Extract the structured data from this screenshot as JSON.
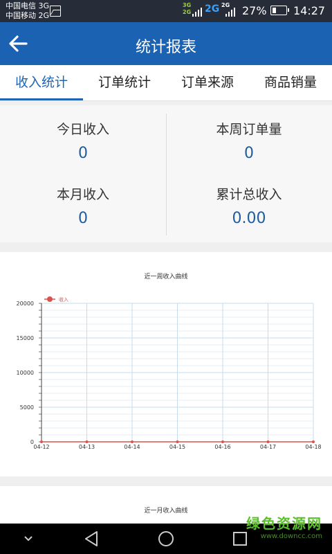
{
  "status_bar": {
    "carrier_1": "中国电信 3G",
    "carrier_2": "中国移动 2G",
    "net_3g_top": "3G",
    "net_3g_bottom": "2G",
    "net_2g": "2G",
    "net_2g_small": "2G",
    "battery": "27%",
    "battery_level": 0.27,
    "time": "14:27",
    "icons": [
      "photo-icon",
      "signal-icon",
      "battery-icon"
    ]
  },
  "header": {
    "title": "统计报表",
    "back_icon": "arrow-left-icon",
    "color": "#1c62b2"
  },
  "tabs": [
    {
      "label": "收入统计",
      "active": true
    },
    {
      "label": "订单统计",
      "active": false
    },
    {
      "label": "订单来源",
      "active": false
    },
    {
      "label": "商品销量",
      "active": false
    }
  ],
  "stats": [
    {
      "label": "今日收入",
      "value": "0"
    },
    {
      "label": "本周订单量",
      "value": "0"
    },
    {
      "label": "本月收入",
      "value": "0"
    },
    {
      "label": "累计总收入",
      "value": "0.00"
    }
  ],
  "chart_data": {
    "type": "line",
    "title": "近一周收入曲线",
    "categories": [
      "04-12",
      "04-13",
      "04-14",
      "04-15",
      "04-16",
      "04-17",
      "04-18"
    ],
    "series": [
      {
        "name": "收入",
        "values": [
          0,
          0,
          0,
          0,
          0,
          0,
          0
        ],
        "color": "#d9534f"
      }
    ],
    "ylim": [
      0,
      20000
    ],
    "yticks": [
      "0",
      "5000",
      "10000",
      "15000",
      "20000"
    ],
    "grid": true,
    "legend": "top-left",
    "grid_color": "#c6dcec"
  },
  "chart2": {
    "title": "近一月收入曲线"
  },
  "nav_bar": {
    "icons": [
      "chevron-down-icon",
      "back-triangle-icon",
      "home-circle-icon",
      "recent-square-icon"
    ]
  },
  "watermark": {
    "logo": "绿色资源网",
    "url": "www.downcc.com"
  }
}
